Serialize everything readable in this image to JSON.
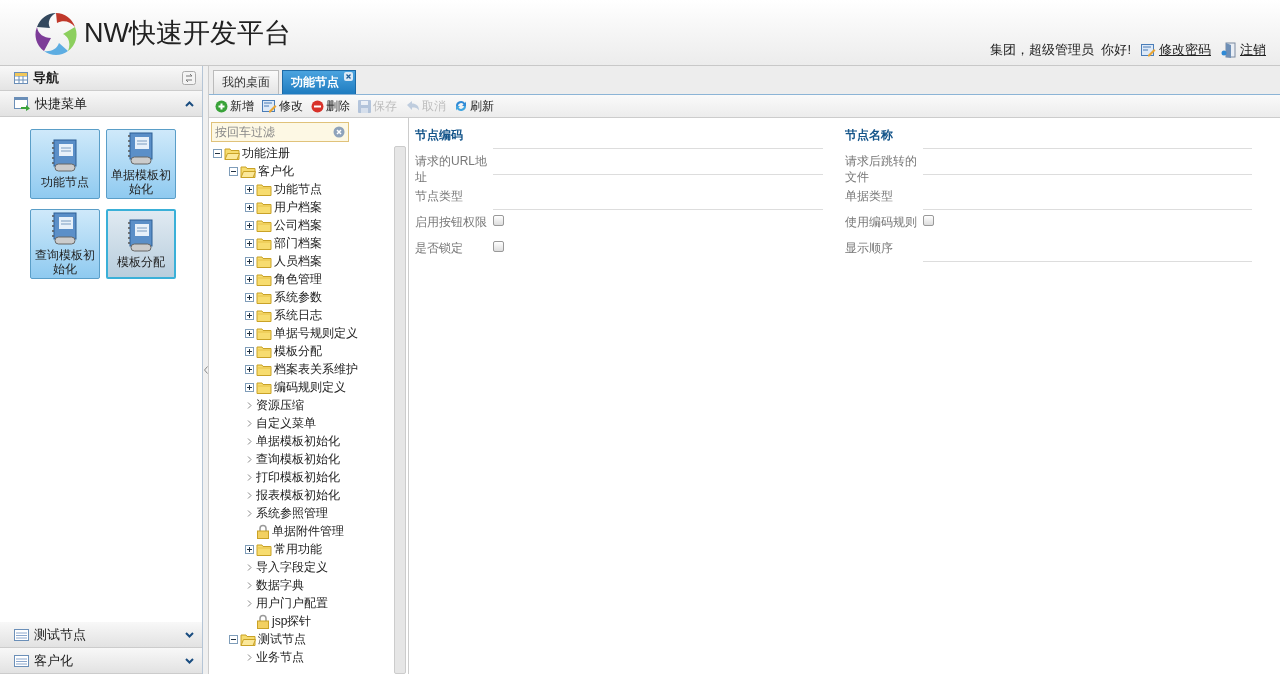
{
  "header": {
    "logo_text": "NW快速开发平台",
    "greeting": "集团，超级管理员  你好!",
    "links": [
      {
        "label": "修改密码",
        "kind": "edit"
      },
      {
        "label": "注销",
        "kind": "logout"
      }
    ]
  },
  "sidebar": {
    "title": "导航",
    "sections": [
      {
        "label": "快捷菜单",
        "expanded": true,
        "shortcuts": [
          {
            "label": "功能节点",
            "selected": false
          },
          {
            "label": "单据模板初始化",
            "selected": false
          },
          {
            "label": "查询模板初始化",
            "selected": false
          },
          {
            "label": "模板分配",
            "selected": true
          }
        ]
      },
      {
        "label": "测试节点",
        "expanded": false
      },
      {
        "label": "客户化",
        "expanded": false
      }
    ]
  },
  "tabs": [
    {
      "label": "我的桌面",
      "selected": false,
      "closable": false
    },
    {
      "label": "功能节点",
      "selected": true,
      "closable": true
    }
  ],
  "toolbar": [
    {
      "label": "新增",
      "kind": "add",
      "disabled": false
    },
    {
      "label": "修改",
      "kind": "edit",
      "disabled": false
    },
    {
      "label": "删除",
      "kind": "delete",
      "disabled": false
    },
    {
      "label": "保存",
      "kind": "save",
      "disabled": true
    },
    {
      "label": "取消",
      "kind": "undo",
      "disabled": true
    },
    {
      "label": "刷新",
      "kind": "refresh",
      "disabled": false
    }
  ],
  "filter": {
    "placeholder": "按回车过滤"
  },
  "tree": [
    {
      "label": "功能注册",
      "kind": "folder",
      "expanded": true,
      "children": [
        {
          "label": "客户化",
          "kind": "folder",
          "expanded": true,
          "children": [
            {
              "label": "功能节点",
              "kind": "folder",
              "expanded": false
            },
            {
              "label": "用户档案",
              "kind": "folder",
              "expanded": false
            },
            {
              "label": "公司档案",
              "kind": "folder",
              "expanded": false
            },
            {
              "label": "部门档案",
              "kind": "folder",
              "expanded": false
            },
            {
              "label": "人员档案",
              "kind": "folder",
              "expanded": false
            },
            {
              "label": "角色管理",
              "kind": "folder",
              "expanded": false
            },
            {
              "label": "系统参数",
              "kind": "folder",
              "expanded": false
            },
            {
              "label": "系统日志",
              "kind": "folder",
              "expanded": false
            },
            {
              "label": "单据号规则定义",
              "kind": "folder",
              "expanded": false
            },
            {
              "label": "模板分配",
              "kind": "folder",
              "expanded": false
            },
            {
              "label": "档案表关系维护",
              "kind": "folder",
              "expanded": false
            },
            {
              "label": "编码规则定义",
              "kind": "folder",
              "expanded": false
            },
            {
              "label": "资源压缩",
              "kind": "leaf"
            },
            {
              "label": "自定义菜单",
              "kind": "leaf"
            },
            {
              "label": "单据模板初始化",
              "kind": "leaf"
            },
            {
              "label": "查询模板初始化",
              "kind": "leaf"
            },
            {
              "label": "打印模板初始化",
              "kind": "leaf"
            },
            {
              "label": "报表模板初始化",
              "kind": "leaf"
            },
            {
              "label": "系统参照管理",
              "kind": "leaf"
            },
            {
              "label": "单据附件管理",
              "kind": "locked"
            },
            {
              "label": "常用功能",
              "kind": "folder",
              "expanded": false
            },
            {
              "label": "导入字段定义",
              "kind": "leaf"
            },
            {
              "label": "数据字典",
              "kind": "leaf"
            },
            {
              "label": "用户门户配置",
              "kind": "leaf"
            },
            {
              "label": "jsp探针",
              "kind": "locked"
            }
          ]
        },
        {
          "label": "测试节点",
          "kind": "folder",
          "expanded": true,
          "children": [
            {
              "label": "业务节点",
              "kind": "leaf"
            }
          ]
        }
      ]
    }
  ],
  "form": {
    "fields": [
      {
        "label": "节点编码",
        "kind": "text",
        "required": true
      },
      {
        "label": "节点名称",
        "kind": "text",
        "required": true
      },
      {
        "label": "请求的URL地址",
        "kind": "text",
        "required": false
      },
      {
        "label": "请求后跳转的文件",
        "kind": "text",
        "required": false
      },
      {
        "label": "节点类型",
        "kind": "text",
        "required": false
      },
      {
        "label": "单据类型",
        "kind": "text",
        "required": false
      },
      {
        "label": "启用按钮权限",
        "kind": "checkbox",
        "required": false,
        "checked": false
      },
      {
        "label": "使用编码规则",
        "kind": "checkbox",
        "required": false,
        "checked": false
      },
      {
        "label": "是否锁定",
        "kind": "checkbox",
        "required": false,
        "checked": false
      },
      {
        "label": "显示顺序",
        "kind": "text",
        "required": false
      }
    ]
  }
}
